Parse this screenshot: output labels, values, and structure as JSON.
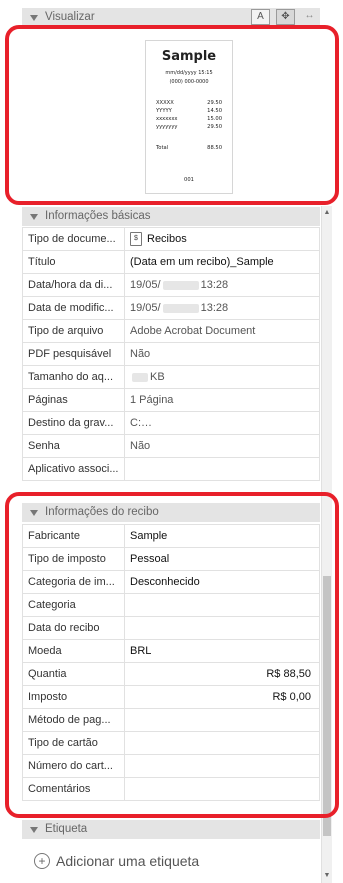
{
  "visualize": {
    "header": "Visualizar",
    "tool_icons": [
      "fit-page-icon",
      "move-icon",
      "fit-width-icon"
    ],
    "tool_glyphs": [
      "A",
      "✥",
      "↔"
    ]
  },
  "receipt": {
    "title": "Sample",
    "date": "mm/dd/yyyy 15:15",
    "phone": "(000) 000-0000",
    "lines": [
      {
        "name": "XXXXX",
        "amount": "29.50"
      },
      {
        "name": "YYYYY",
        "amount": "14.50"
      },
      {
        "name": "xxxxxxx",
        "amount": "15.00"
      },
      {
        "name": "yyyyyyy",
        "amount": "29.50"
      }
    ],
    "total_label": "Total",
    "total": "88.50",
    "number": "001"
  },
  "basic_info": {
    "header": "Informações básicas",
    "rows": [
      {
        "key": "Tipo de docume...",
        "value": "Recibos"
      },
      {
        "key": "Título",
        "value": "(Data em um recibo)_Sample"
      },
      {
        "key": "Data/hora da di...",
        "value_prefix": "19/05/",
        "value_suffix": "13:28"
      },
      {
        "key": "Data de modific...",
        "value_prefix": "19/05/",
        "value_suffix": "13:28"
      },
      {
        "key": "Tipo de arquivo",
        "value": "Adobe Acrobat Document"
      },
      {
        "key": "PDF pesquisável",
        "value": "Não"
      },
      {
        "key": "Tamanho do aq...",
        "value_suffix": "KB"
      },
      {
        "key": "Páginas",
        "value": "1 Página"
      },
      {
        "key": "Destino da grav...",
        "value_prefix": "C:",
        "value_suffix": "..."
      },
      {
        "key": "Senha",
        "value": "Não"
      },
      {
        "key": "Aplicativo associ...",
        "value": ""
      }
    ]
  },
  "receipt_info": {
    "header": "Informações do recibo",
    "rows": [
      {
        "key": "Fabricante",
        "value": "Sample"
      },
      {
        "key": "Tipo de imposto",
        "value": "Pessoal"
      },
      {
        "key": "Categoria de im...",
        "value": "Desconhecido"
      },
      {
        "key": "Categoria",
        "value": ""
      },
      {
        "key": "Data do recibo",
        "value": ""
      },
      {
        "key": "Moeda",
        "value": "BRL"
      },
      {
        "key": "Quantia",
        "value": "R$ 88,50"
      },
      {
        "key": "Imposto",
        "value": "R$ 0,00"
      },
      {
        "key": "Método de pag...",
        "value": ""
      },
      {
        "key": "Tipo de cartão",
        "value": ""
      },
      {
        "key": "Número do cart...",
        "value": ""
      },
      {
        "key": "Comentários",
        "value": ""
      }
    ]
  },
  "tag": {
    "header": "Etiqueta",
    "add_label": "Adicionar uma etiqueta"
  },
  "highlight_color": "#e8202a"
}
